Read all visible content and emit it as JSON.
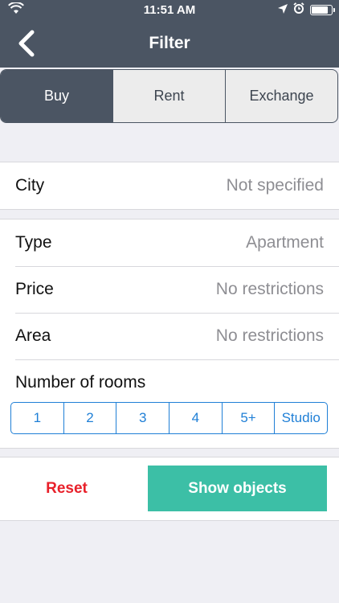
{
  "status_bar": {
    "time": "11:51 AM",
    "icons": [
      "wifi-icon",
      "location-icon",
      "alarm-icon",
      "battery-icon"
    ]
  },
  "nav": {
    "title": "Filter",
    "back_icon": "chevron-left-icon"
  },
  "deal_type": {
    "options": [
      "Buy",
      "Rent",
      "Exchange"
    ],
    "selected": "Buy"
  },
  "city": {
    "label": "City",
    "value": "Not specified"
  },
  "fields": [
    {
      "label": "Type",
      "value": "Apartment"
    },
    {
      "label": "Price",
      "value": "No restrictions"
    },
    {
      "label": "Area",
      "value": "No restrictions"
    }
  ],
  "rooms": {
    "label": "Number of rooms",
    "options": [
      "1",
      "2",
      "3",
      "4",
      "5+",
      "Studio"
    ]
  },
  "actions": {
    "reset_label": "Reset",
    "show_label": "Show objects"
  },
  "colors": {
    "header": "#4b5563",
    "accent_blue": "#1f7fd6",
    "reset_red": "#e8202a",
    "show_green": "#3cbfa6"
  }
}
